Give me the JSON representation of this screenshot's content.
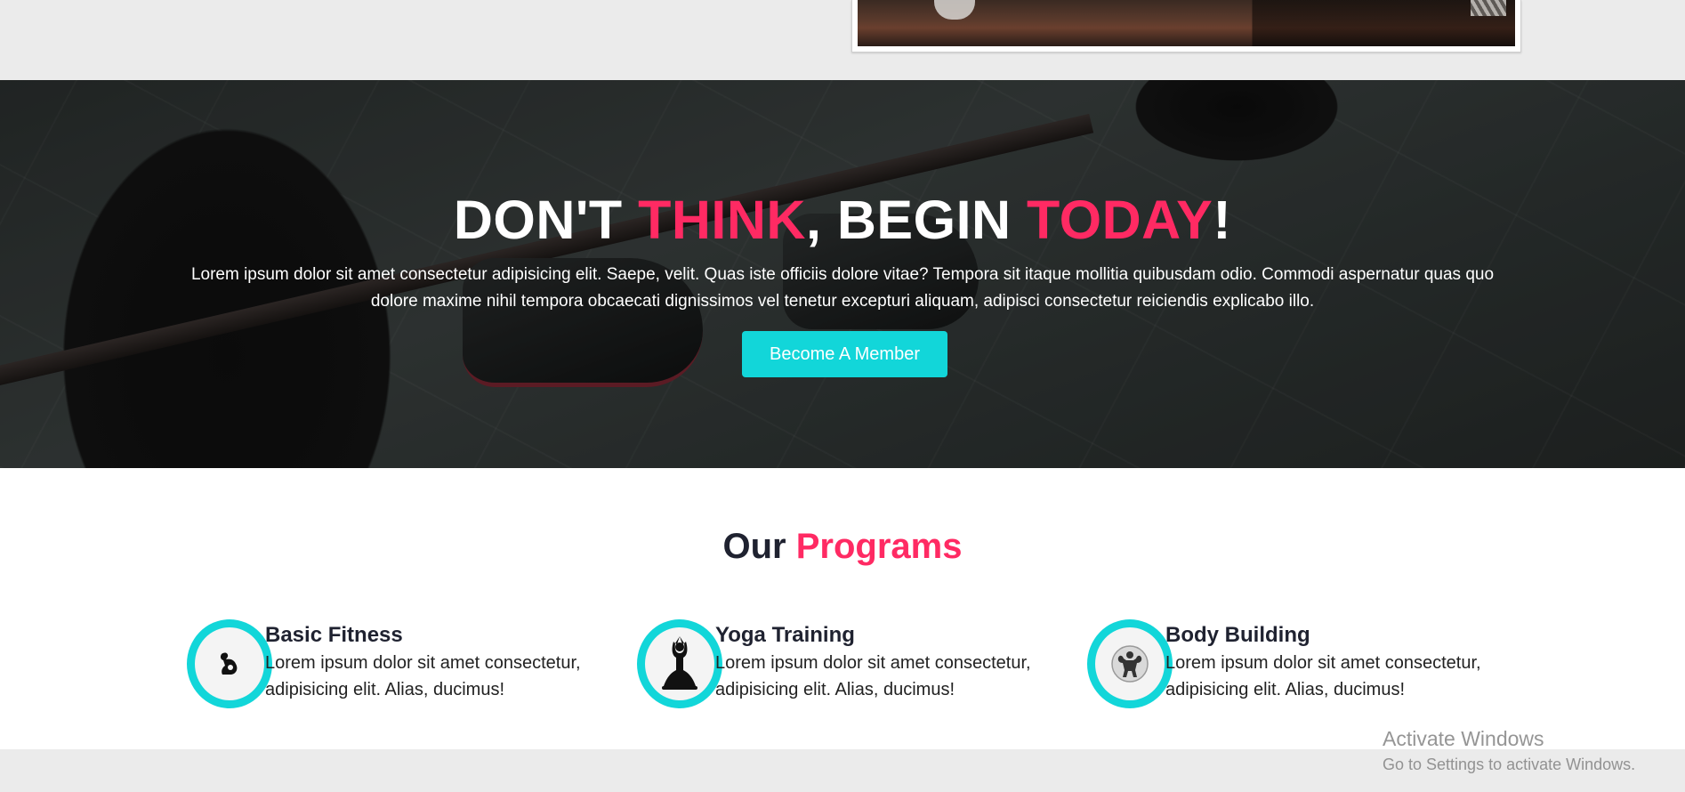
{
  "hero": {
    "title_parts": [
      "DON'T ",
      "THINK",
      ", BEGIN ",
      "TODAY",
      "!"
    ],
    "text": "Lorem ipsum dolor sit amet consectetur adipisicing elit. Saepe, velit. Quas iste officiis dolore vitae? Tempora sit itaque mollitia quibusdam odio. Commodi aspernatur quas quo dolore maxime nihil tempora obcaecati dignissimos vel tenetur excepturi aliquam, adipisci consectetur reiciendis explicabo illo.",
    "button_label": "Become A Member"
  },
  "programs": {
    "title_parts": [
      "Our ",
      "Programs"
    ],
    "items": [
      {
        "name": "Basic Fitness",
        "description": "Lorem ipsum dolor sit amet consectetur, adipisicing elit. Alias, ducimus!",
        "icon": "flexing-arm-icon"
      },
      {
        "name": "Yoga Training",
        "description": "Lorem ipsum dolor sit amet consectetur, adipisicing elit. Alias, ducimus!",
        "icon": "yoga-pose-icon"
      },
      {
        "name": "Body Building",
        "description": "Lorem ipsum dolor sit amet consectetur, adipisicing elit. Alias, ducimus!",
        "icon": "bodybuilder-icon"
      }
    ]
  },
  "watermark": {
    "title": "Activate Windows",
    "subtitle": "Go to Settings to activate Windows."
  },
  "colors": {
    "accent_pink": "#ff2a63",
    "accent_cyan": "#12d6d9",
    "heading_dark": "#1f2230"
  }
}
